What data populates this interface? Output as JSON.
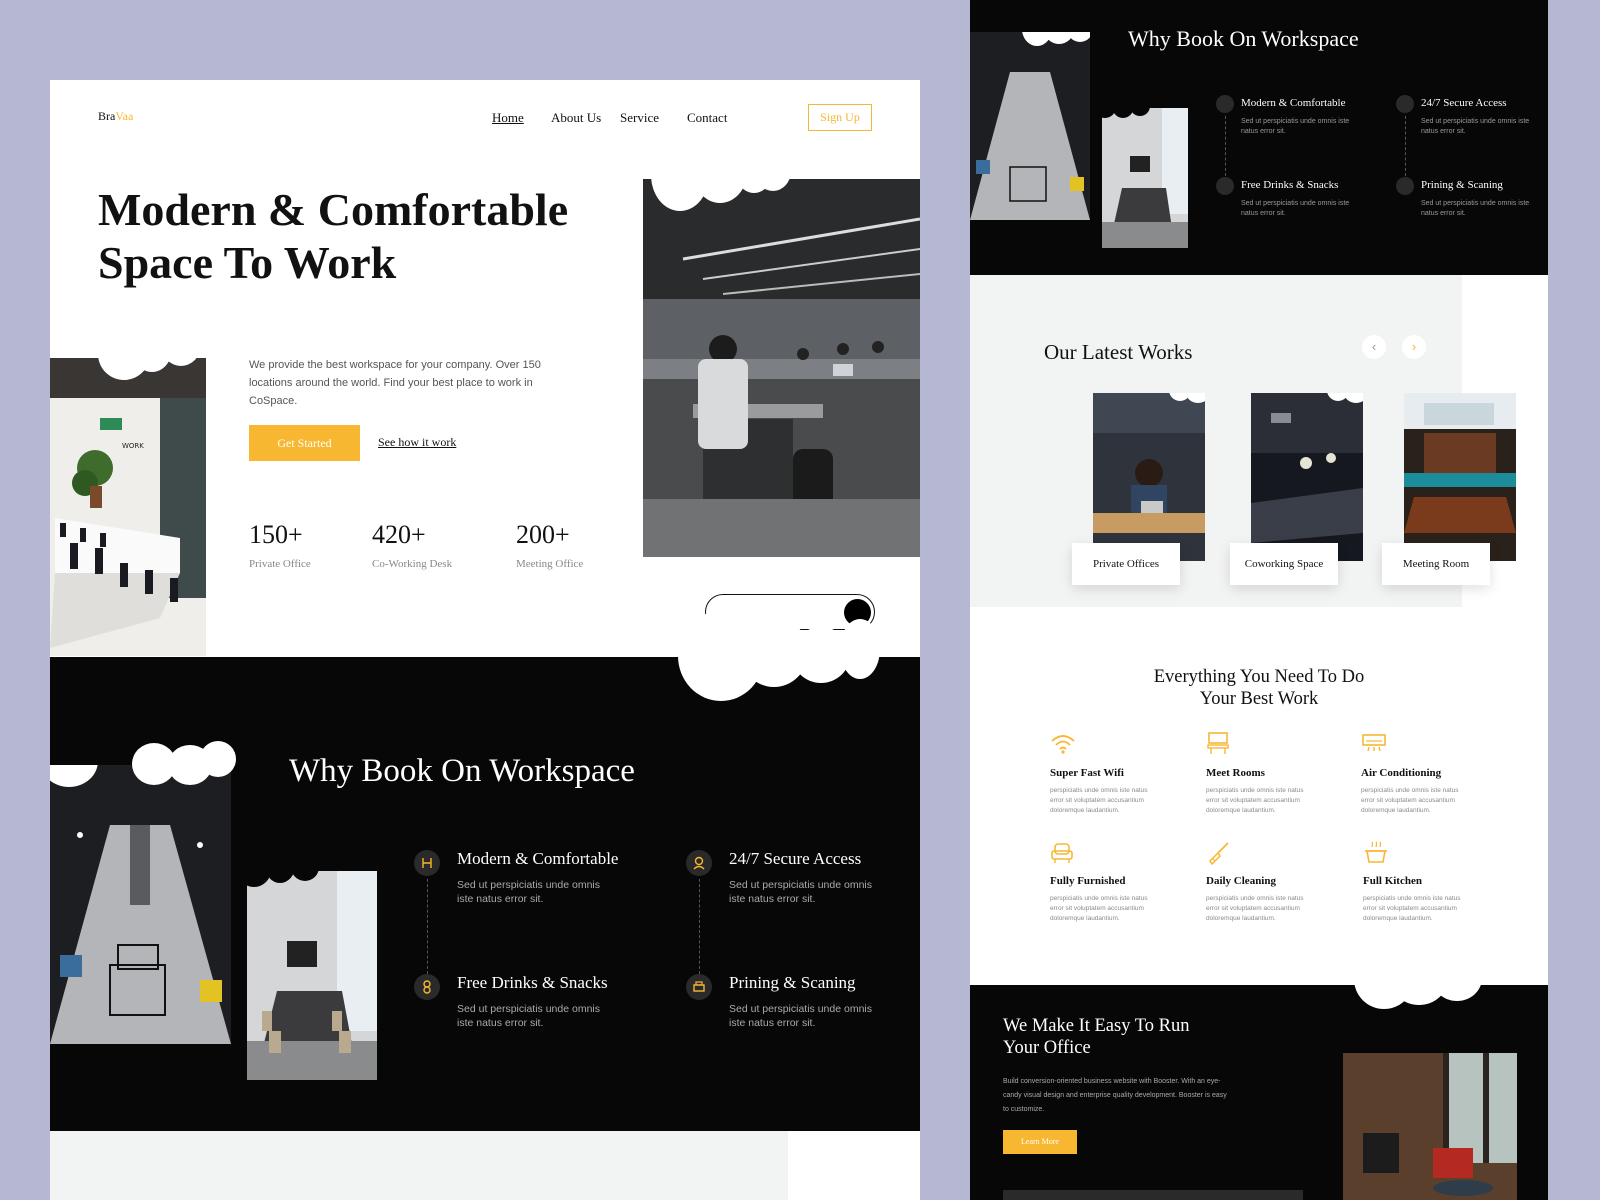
{
  "brand": {
    "prefix": "Bra",
    "suffix": "Vaa"
  },
  "nav": {
    "items": [
      "Home",
      "About Us",
      "Service",
      "Contact"
    ],
    "signup": "Sign Up"
  },
  "hero": {
    "title_line1": "Modern & Comfortable",
    "title_line2": "Space To Work",
    "description": "We provide the best workspace for your company. Over 150 locations around the world. Find your best place to work in CoSpace.",
    "primary_cta": "Get Started",
    "secondary_cta": "See how it work"
  },
  "stats": [
    {
      "value": "150+",
      "label": "Private Office"
    },
    {
      "value": "420+",
      "label": "Co-Working Desk"
    },
    {
      "value": "200+",
      "label": "Meeting Office"
    }
  ],
  "why": {
    "title": "Why Book On Workspace",
    "features": [
      {
        "title": "Modern & Comfortable",
        "desc": "Sed ut perspiciatis unde omnis iste natus error sit."
      },
      {
        "title": "24/7 Secure Access",
        "desc": "Sed ut perspiciatis unde omnis iste natus error sit."
      },
      {
        "title": "Free Drinks & Snacks",
        "desc": "Sed ut perspiciatis unde omnis iste natus error sit."
      },
      {
        "title": "Prining & Scaning",
        "desc": "Sed ut perspiciatis unde omnis iste natus error sit."
      }
    ]
  },
  "works": {
    "title": "Our Latest Works",
    "items": [
      "Private Offices",
      "Coworking Space",
      "Meeting Room"
    ]
  },
  "amenities": {
    "title_line1": "Everything You Need To Do",
    "title_line2": "Your Best Work",
    "desc": "perspiciatis unde omnis iste natus error sit voluptatem accusantium doloremque laudantium.",
    "items": [
      {
        "title": "Super Fast Wifi",
        "icon": "wifi-icon"
      },
      {
        "title": "Meet Rooms",
        "icon": "meeting-room-icon"
      },
      {
        "title": "Air Conditioning",
        "icon": "air-conditioner-icon"
      },
      {
        "title": "Fully Furnished",
        "icon": "armchair-icon"
      },
      {
        "title": "Daily Cleaning",
        "icon": "broom-icon"
      },
      {
        "title": "Full Kitchen",
        "icon": "cooking-pot-icon"
      }
    ]
  },
  "office": {
    "title_line1": "We Make It Easy To Run",
    "title_line2": "Your Office",
    "description": "Build conversion-oriented business website with Booster. With an eye-candy visual design and enterprise quality development. Booster is easy to customize.",
    "cta": "Learn More"
  },
  "colors": {
    "accent": "#f7b731",
    "dark": "#070707",
    "background": "#b6b8d3",
    "panel": "#f2f3f3"
  }
}
